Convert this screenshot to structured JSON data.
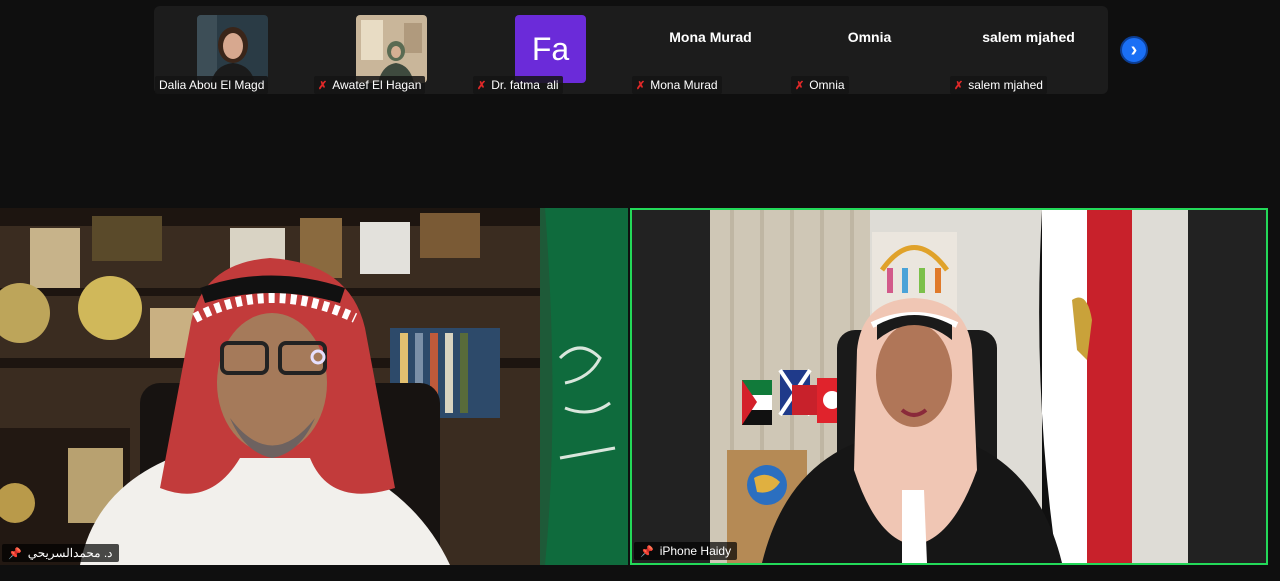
{
  "strip": {
    "participants": [
      {
        "name": "Dalia Abou El Magd",
        "type": "video",
        "muted": false
      },
      {
        "name": "Awatef El Hagan",
        "type": "video",
        "muted": true
      },
      {
        "name": "Dr. fatma  ali",
        "type": "initials",
        "initials": "Fa",
        "muted": true
      },
      {
        "name": "Mona Murad",
        "type": "text",
        "muted": true
      },
      {
        "name": "Omnia",
        "type": "text",
        "muted": true
      },
      {
        "name": "salem mjahed",
        "type": "text",
        "muted": true
      }
    ],
    "next_icon": "chevron-right-icon"
  },
  "main": {
    "left": {
      "name": "د. محمدالسريحي"
    },
    "right": {
      "name": "iPhone Haidy",
      "active_speaker": true
    }
  },
  "colors": {
    "active_border": "#23d959",
    "next_button": "#1a6ff5",
    "initials_bg": "#6b2bd9",
    "muted_icon": "#e02828"
  }
}
